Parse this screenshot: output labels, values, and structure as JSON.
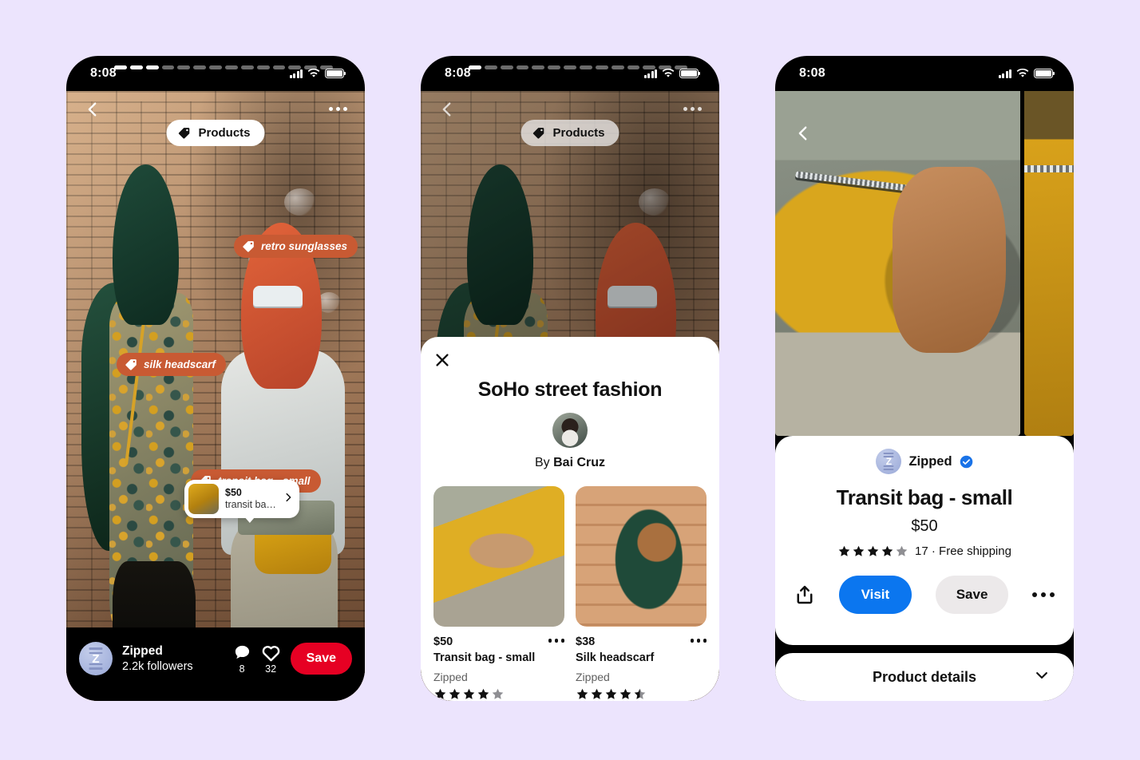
{
  "theme": {
    "page_background": "#ece4fd",
    "tag_orange": "#c85a33",
    "save_red": "#e60023",
    "visit_blue": "#0b76ef",
    "save_grey": "#ece9ea",
    "brand_avatar_blue": "#aebbe4",
    "verified_blue": "#1a73e8"
  },
  "status_bar": {
    "time": "8:08",
    "signal_icon": "cellular-signal-icon",
    "wifi_icon": "wifi-icon",
    "battery_icon": "battery-icon"
  },
  "phone1": {
    "name": "idea-pin-story-screen",
    "story_progress": {
      "total": 14,
      "completed": 3
    },
    "back_icon": "chevron-left-icon",
    "overflow_icon": "more-options-icon",
    "products_pill": {
      "label": "Products",
      "icon": "price-tag-icon"
    },
    "hotspot_tags": [
      {
        "label": "retro sunglasses",
        "icon": "price-tag-icon"
      },
      {
        "label": "silk headscarf",
        "icon": "price-tag-icon"
      },
      {
        "label": "transit bag - small",
        "icon": "price-tag-icon"
      }
    ],
    "product_preview": {
      "price": "$50",
      "name": "transit bag...",
      "chevron_icon": "chevron-right-icon"
    },
    "creator": {
      "avatar_icon": "zipped-brand-avatar",
      "name": "Zipped",
      "followers": "2.2k followers"
    },
    "stats": [
      {
        "icon": "comment-icon",
        "count": "8"
      },
      {
        "icon": "heart-icon",
        "count": "32"
      }
    ],
    "save_label": "Save"
  },
  "phone2": {
    "name": "products-sheet-screen",
    "story_progress": {
      "total": 14,
      "completed": 1
    },
    "back_icon": "chevron-left-icon",
    "overflow_icon": "more-options-icon",
    "products_pill": {
      "label": "Products",
      "icon": "price-tag-icon"
    },
    "sheet": {
      "close_icon": "close-icon",
      "title": "SoHo street fashion",
      "avatar_icon": "creator-avatar",
      "by_prefix": "By",
      "author": "Bai Cruz",
      "products": [
        {
          "image_icon": "transit-bag-photo",
          "price": "$50",
          "name": "Transit bag - small",
          "brand": "Zipped",
          "rating": 4,
          "rating_max": 5,
          "overflow_icon": "more-options-icon"
        },
        {
          "image_icon": "silk-headscarf-photo",
          "price": "$38",
          "name": "Silk headscarf",
          "brand": "Zipped",
          "rating": 4.5,
          "rating_max": 5,
          "overflow_icon": "more-options-icon"
        }
      ]
    }
  },
  "phone3": {
    "name": "product-detail-screen",
    "back_icon": "chevron-left-icon",
    "gallery": [
      {
        "icon": "transit-bag-photo-large"
      },
      {
        "icon": "transit-bag-photo-detail"
      }
    ],
    "brand": {
      "avatar_icon": "zipped-brand-avatar",
      "name": "Zipped",
      "verified_icon": "verified-badge-icon"
    },
    "title": "Transit bag - small",
    "price": "$50",
    "rating": 4,
    "rating_max": 5,
    "rating_count": "17",
    "rating_meta": "17 · Free shipping",
    "actions": {
      "share_icon": "share-icon",
      "visit_label": "Visit",
      "save_label": "Save",
      "overflow_icon": "more-options-icon"
    },
    "details": {
      "label": "Product details",
      "chevron_icon": "chevron-down-icon"
    }
  }
}
